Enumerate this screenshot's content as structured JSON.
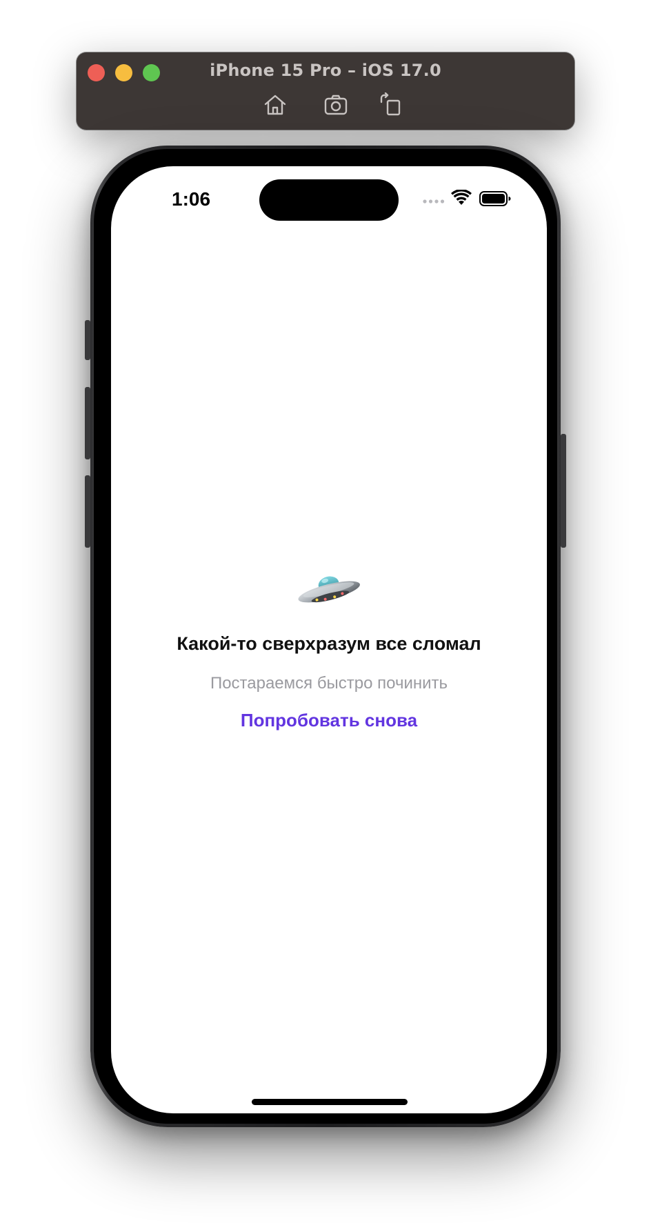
{
  "simulator": {
    "title": "iPhone 15 Pro – iOS 17.0",
    "toolbar": {
      "home_icon": "home-icon",
      "screenshot_icon": "camera-icon",
      "rotate_icon": "rotate-icon"
    },
    "traffic_lights": {
      "close": "#ee5f56",
      "minimize": "#f7bd3f",
      "zoom": "#5fc651"
    }
  },
  "status_bar": {
    "time": "1:06",
    "icons": [
      "cellular-icon",
      "wifi-icon",
      "battery-icon"
    ]
  },
  "error_screen": {
    "icon": "ufo-icon",
    "title": "Какой-то сверхразум все сломал",
    "subtitle": "Постараемся быстро починить",
    "retry_label": "Попробовать снова",
    "accent_color": "#6235e0"
  }
}
